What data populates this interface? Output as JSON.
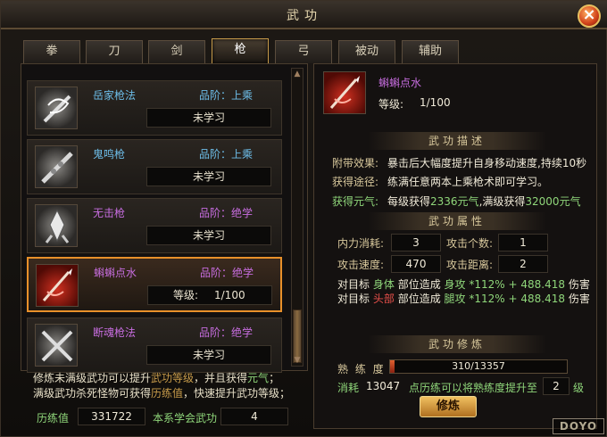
{
  "window": {
    "title": "武功",
    "close_icon": "close-x-icon"
  },
  "tabs": [
    {
      "label": "拳"
    },
    {
      "label": "刀"
    },
    {
      "label": "剑"
    },
    {
      "label": "枪",
      "active": true
    },
    {
      "label": "弓"
    },
    {
      "label": "被动"
    },
    {
      "label": "辅助"
    }
  ],
  "skills": [
    {
      "name": "岳家枪法",
      "grade": "品阶：上乘",
      "state": "未学习",
      "icon": "spear-swirl-icon"
    },
    {
      "name": "鬼鸣枪",
      "grade": "品阶：上乘",
      "state": "未学习",
      "icon": "spear-chain-icon"
    },
    {
      "name": "无击枪",
      "grade": "品阶：绝学",
      "state": "未学习",
      "icon": "spear-tip-icon"
    },
    {
      "name": "蝌蝌点水",
      "grade": "品阶：绝学",
      "level_label": "等级:",
      "level_value": "1/100",
      "icon": "red-spear-icon",
      "selected": true
    },
    {
      "name": "断魂枪法",
      "grade": "品阶：绝学",
      "state": "未学习",
      "icon": "crossed-spears-icon"
    }
  ],
  "left_info": {
    "line1_a": "修炼未满级武功可以提升",
    "line1_b": "武功等级",
    "line1_c": "，并且获得",
    "line1_d": "元气",
    "line1_e": "；",
    "line2_a": "满级武功杀死怪物可获得",
    "line2_b": "历练值",
    "line2_c": "，快速提升武功等级；",
    "exp_label": "历练值",
    "exp_value": "331722",
    "learned_label": "本系学会武功",
    "learned_value": "4"
  },
  "detail": {
    "name": "蝌蝌点水",
    "level_label": "等级:",
    "level_value": "1/100",
    "desc_header": "武功描述",
    "effect_label": "附带效果:",
    "effect_text": "暴击后大幅度提升自身移动速度,持续10秒",
    "source_label": "获得途径:",
    "source_text": "练满任意两本上乘枪术即可学习。",
    "yuanqi_label": "获得元气:",
    "yuanqi_a": "每级获得",
    "yuanqi_b": "2336元气",
    "yuanqi_c": ",满级获得",
    "yuanqi_d": "32000元气",
    "attr_header": "武功属性",
    "mp_label": "内力消耗:",
    "mp_value": "3",
    "hits_label": "攻击个数:",
    "hits_value": "1",
    "speed_label": "攻击速度:",
    "speed_value": "470",
    "range_label": "攻击距离:",
    "range_value": "2",
    "bonus1_a": "对目标",
    "bonus1_b": "身体",
    "bonus1_c": "部位造成",
    "bonus1_d": "身攻 *112%",
    "bonus1_e": "+ 488.418",
    "bonus1_f": "伤害",
    "bonus2_a": "对目标",
    "bonus2_b": "头部",
    "bonus2_c": "部位造成",
    "bonus2_d": "腿攻 *112%",
    "bonus2_e": "+ 488.418",
    "bonus2_f": "伤害",
    "train_header": "武功修炼",
    "proficiency_label": "熟 练 度",
    "proficiency_value": "310/13357",
    "proficiency_fraction": 0.023,
    "consume_label": "消耗",
    "consume_value": "13047",
    "consume_text": "点历练可以将熟练度提升至",
    "consume_level": "2",
    "consume_unit": "级",
    "train_button": "修炼"
  },
  "watermark": "DOYO"
}
